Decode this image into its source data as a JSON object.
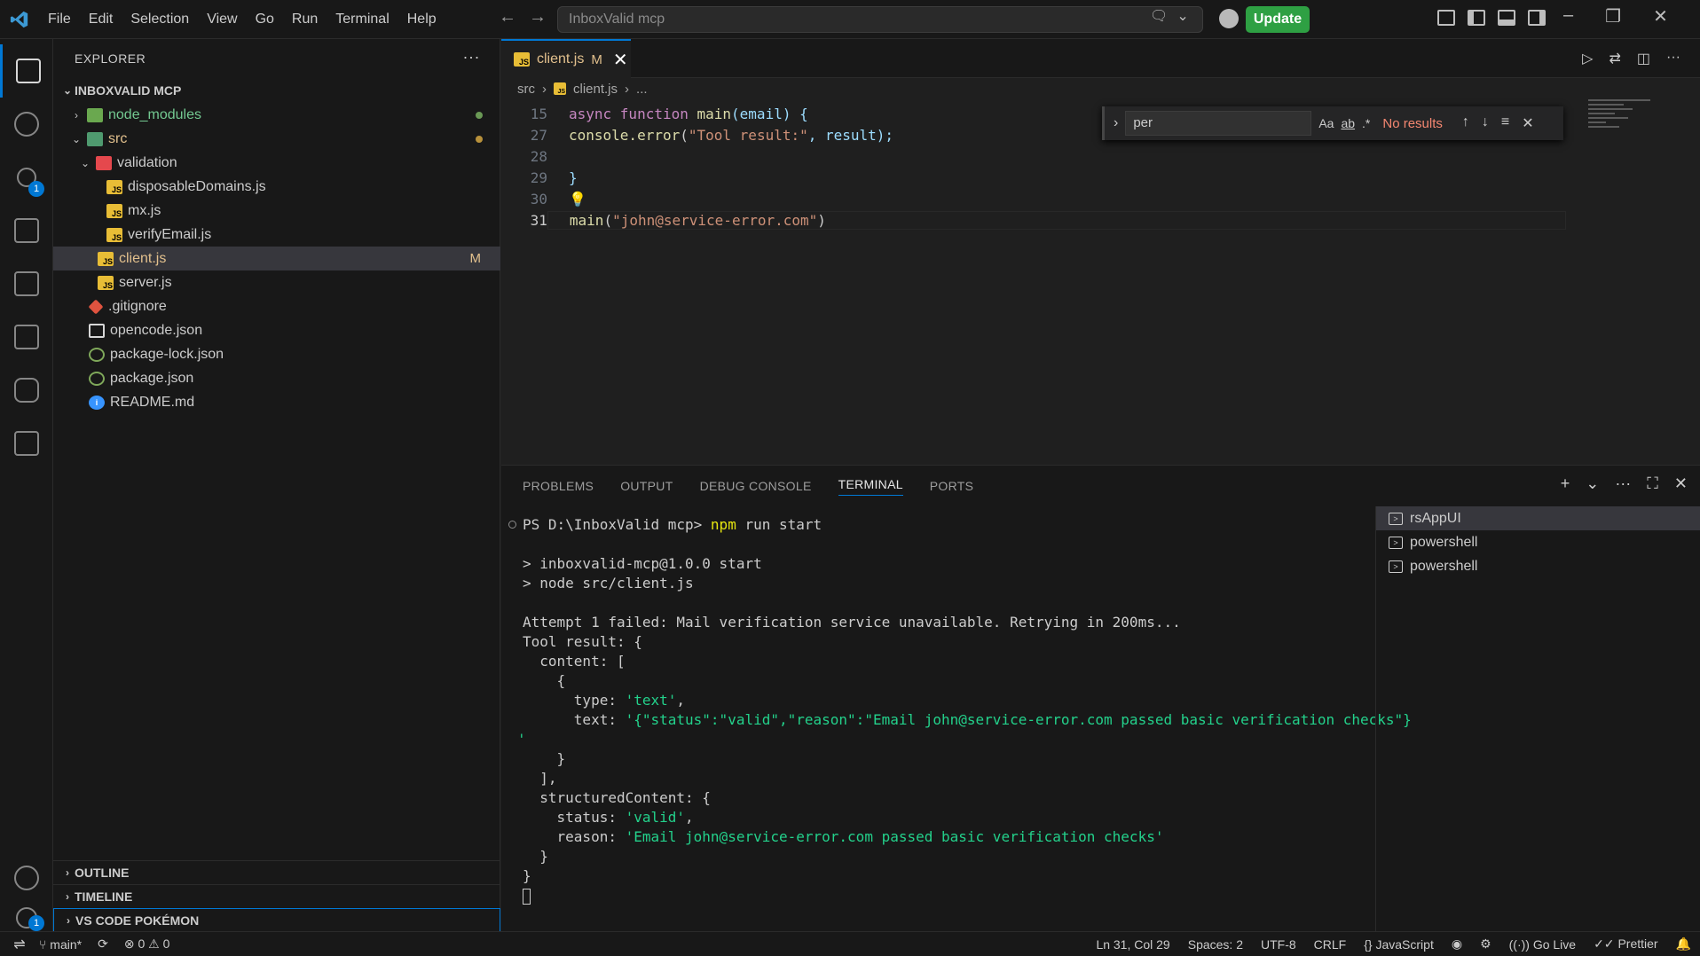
{
  "menu": [
    "File",
    "Edit",
    "Selection",
    "View",
    "Go",
    "Run",
    "Terminal",
    "Help"
  ],
  "command_center": {
    "placeholder": "InboxValid mcp"
  },
  "update_label": "Update",
  "explorer": {
    "title": "EXPLORER",
    "more": "···",
    "root": "INBOXVALID MCP",
    "items": [
      {
        "label": "node_modules"
      },
      {
        "label": "src"
      },
      {
        "label": "validation"
      },
      {
        "label": "disposableDomains.js"
      },
      {
        "label": "mx.js"
      },
      {
        "label": "verifyEmail.js"
      },
      {
        "label": "client.js",
        "status": "M"
      },
      {
        "label": "server.js"
      },
      {
        "label": ".gitignore"
      },
      {
        "label": "opencode.json"
      },
      {
        "label": "package-lock.json"
      },
      {
        "label": "package.json"
      },
      {
        "label": "README.md"
      }
    ],
    "sections": [
      "OUTLINE",
      "TIMELINE",
      "VS CODE POKÉMON"
    ]
  },
  "editor": {
    "tab": {
      "label": "client.js",
      "status": "M"
    },
    "breadcrumb": [
      "src",
      "client.js",
      "..."
    ],
    "lines": [
      {
        "num": "15"
      },
      {
        "num": "27"
      },
      {
        "num": "28"
      },
      {
        "num": "29"
      },
      {
        "num": "30"
      },
      {
        "num": "31"
      }
    ],
    "code": {
      "l15_kw": "async function",
      "l15_fn": "main",
      "l15_rest": "(email) {",
      "l27_a": "console.",
      "l27_fn": "error",
      "l27_b": "(",
      "l27_str": "\"Tool result:\"",
      "l27_c": ", result);",
      "l29": "}",
      "l31_fn": "main",
      "l31_a": "(",
      "l31_str": "\"john@service-error.com\"",
      "l31_b": ")"
    },
    "find": {
      "value": "per",
      "opt_case": "Aa",
      "opt_word": "ab",
      "opt_regex": ".*",
      "result": "No results"
    }
  },
  "panel": {
    "tabs": [
      "PROBLEMS",
      "OUTPUT",
      "DEBUG CONSOLE",
      "TERMINAL",
      "PORTS"
    ],
    "terminal_lines": {
      "prompt": "PS D:\\InboxValid mcp> ",
      "cmd_npm": "npm",
      "cmd_rest": " run start",
      "l1": "> inboxvalid-mcp@1.0.0 start",
      "l2": "> node src/client.js",
      "l3": "Attempt 1 failed: Mail verification service unavailable. Retrying in 200ms...",
      "l4": "Tool result: {",
      "l5": "  content: [",
      "l6": "    {",
      "l7a": "      type: ",
      "l7b": "'text'",
      "l7c": ",",
      "l8a": "      text: ",
      "l8b": "'{\"status\":\"valid\",\"reason\":\"Email john@service-error.com passed basic verification checks\"}",
      "l8c": "'",
      "l9": "    }",
      "l10": "  ],",
      "l11": "  structuredContent: {",
      "l12a": "    status: ",
      "l12b": "'valid'",
      "l12c": ",",
      "l13a": "    reason: ",
      "l13b": "'Email john@service-error.com passed basic verification checks'",
      "l14": "  }",
      "l15": "}"
    },
    "terminals": [
      "rsAppUI",
      "powershell",
      "powershell"
    ]
  },
  "status": {
    "branch": "main*",
    "errors": "0",
    "warnings": "0",
    "position": "Ln 31, Col 29",
    "spaces": "Spaces: 2",
    "encoding": "UTF-8",
    "eol": "CRLF",
    "language": "JavaScript",
    "golive": "Go Live",
    "prettier": "Prettier"
  },
  "icons": {
    "activity": [
      "files-icon",
      "search-icon",
      "source-control-icon",
      "run-debug-icon",
      "remote-explorer-icon",
      "extensions-icon",
      "python-icon",
      "bookmark-icon",
      "account-icon",
      "settings-gear-icon"
    ],
    "scm_badge": "1",
    "settings_badge": "1"
  }
}
